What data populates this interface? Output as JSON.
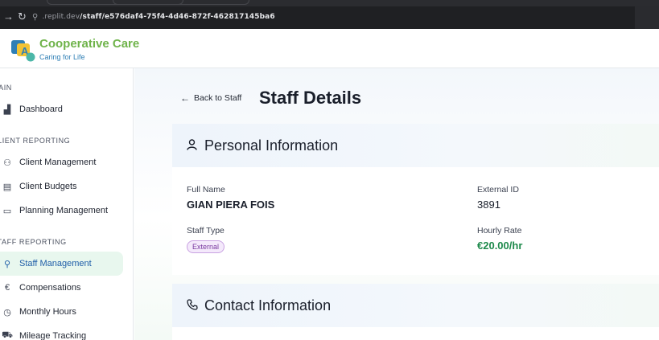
{
  "browser": {
    "url_domain": ".replit.dev",
    "url_path": "/staff/e576daf4-75f4-4d46-872f-462817145ba6"
  },
  "brand": {
    "name": "Cooperative Care",
    "tagline": "Caring for Life"
  },
  "sidebar": {
    "sections": [
      {
        "label": "MAIN",
        "items": [
          {
            "label": "Dashboard",
            "icon": "bar-chart-icon",
            "active": false
          }
        ]
      },
      {
        "label": "CLIENT REPORTING",
        "items": [
          {
            "label": "Client Management",
            "icon": "users-icon",
            "active": false
          },
          {
            "label": "Client Budgets",
            "icon": "calculator-icon",
            "active": false
          },
          {
            "label": "Planning Management",
            "icon": "calendar-icon",
            "active": false
          }
        ]
      },
      {
        "label": "STAFF REPORTING",
        "items": [
          {
            "label": "Staff Management",
            "icon": "user-check-icon",
            "active": true
          },
          {
            "label": "Compensations",
            "icon": "euro-icon",
            "active": false
          },
          {
            "label": "Monthly Hours",
            "icon": "clock-icon",
            "active": false
          },
          {
            "label": "Mileage Tracking",
            "icon": "car-icon",
            "active": false
          }
        ]
      }
    ]
  },
  "main": {
    "back_label": "Back to Staff",
    "title": "Staff Details",
    "personal": {
      "title": "Personal Information",
      "full_name_label": "Full Name",
      "full_name": "GIAN PIERA FOIS",
      "external_id_label": "External ID",
      "external_id": "3891",
      "staff_type_label": "Staff Type",
      "staff_type": "External",
      "hourly_rate_label": "Hourly Rate",
      "hourly_rate": "€20.00/hr"
    },
    "contact": {
      "title": "Contact Information"
    }
  },
  "colors": {
    "brand_green": "#6fb34a",
    "brand_blue": "#2f7fb5",
    "active_bg": "#e8f7ee",
    "active_text": "#1f5ea8",
    "money_green": "#1f8a4c",
    "badge_purple": "#7a3aa0"
  }
}
